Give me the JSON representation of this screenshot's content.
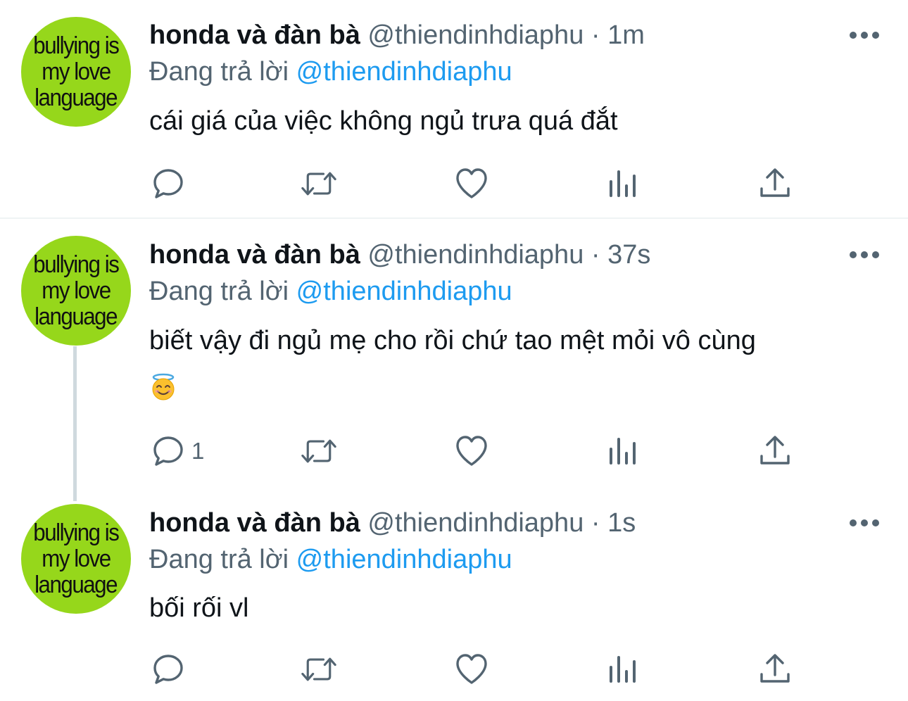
{
  "colors": {
    "avatar_bg": "#96d71b",
    "mention": "#1d9bf0",
    "secondary_text": "#536471",
    "primary_text": "#0f1419",
    "divider": "#eff3f4",
    "thread_line": "#cfd9de"
  },
  "tweets": [
    {
      "avatar_text": [
        "bullying is",
        "my love",
        "language"
      ],
      "display_name": "honda và đàn bà",
      "handle": "@thiendinhdiaphu",
      "separator": "·",
      "time": "1m",
      "replying_label": "Đang trả lời",
      "replying_to": "@thiendinhdiaphu",
      "text": "cái giá của việc không ngủ trưa quá đắt",
      "emoji": "",
      "reply_count": "",
      "actions": [
        "reply-icon",
        "retweet-icon",
        "like-icon",
        "analytics-icon",
        "share-icon"
      ]
    },
    {
      "avatar_text": [
        "bullying is",
        "my love",
        "language"
      ],
      "display_name": "honda và đàn bà",
      "handle": "@thiendinhdiaphu",
      "separator": "·",
      "time": "37s",
      "replying_label": "Đang trả lời",
      "replying_to": "@thiendinhdiaphu",
      "text": "biết vậy đi ngủ mẹ cho rồi chứ tao mệt mỏi vô cùng",
      "emoji": "smiling-face-with-halo",
      "reply_count": "1",
      "actions": [
        "reply-icon",
        "retweet-icon",
        "like-icon",
        "analytics-icon",
        "share-icon"
      ]
    },
    {
      "avatar_text": [
        "bullying is",
        "my love",
        "language"
      ],
      "display_name": "honda và đàn bà",
      "handle": "@thiendinhdiaphu",
      "separator": "·",
      "time": "1s",
      "replying_label": "Đang trả lời",
      "replying_to": "@thiendinhdiaphu",
      "text": "bối rối vl",
      "emoji": "",
      "reply_count": "",
      "actions": [
        "reply-icon",
        "retweet-icon",
        "like-icon",
        "analytics-icon",
        "share-icon"
      ]
    }
  ]
}
